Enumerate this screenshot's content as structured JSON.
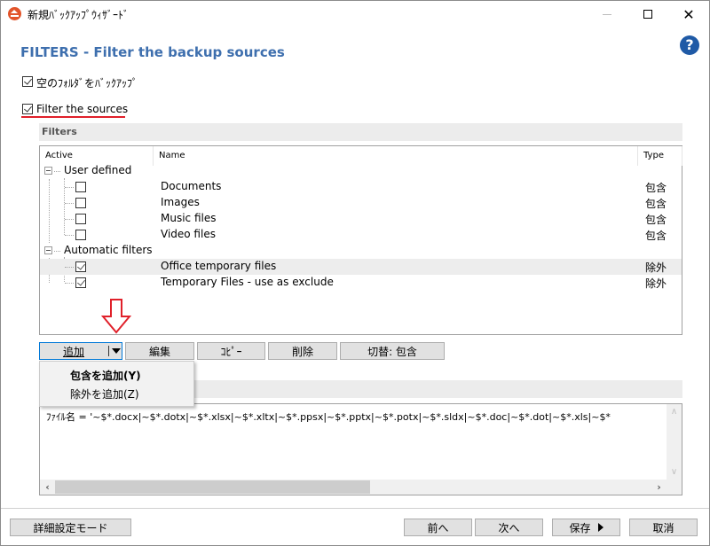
{
  "window": {
    "title": "新規ﾊﾞｯｸｱｯﾌﾟｳｨｻﾞｰﾄﾞ",
    "controls": {
      "minimize": "—",
      "maximize": "☐",
      "close": "✕"
    }
  },
  "header": {
    "title": "FILTERS - Filter the backup sources",
    "help_icon": "?"
  },
  "options": {
    "backup_empty_folders": {
      "label": "空のﾌｫﾙﾀﾞをﾊﾞｯｸｱｯﾌﾟ",
      "checked": true
    },
    "filter_sources": {
      "label": "Filter the sources",
      "checked": true
    }
  },
  "filters_section": {
    "title": "Filters",
    "columns": {
      "active": "Active",
      "name": "Name",
      "type": "Type"
    },
    "groups": [
      {
        "label": "User defined",
        "items": [
          {
            "name": "Documents",
            "type": "包含",
            "active": false
          },
          {
            "name": "Images",
            "type": "包含",
            "active": false
          },
          {
            "name": "Music files",
            "type": "包含",
            "active": false
          },
          {
            "name": "Video files",
            "type": "包含",
            "active": false
          }
        ]
      },
      {
        "label": "Automatic filters",
        "items": [
          {
            "name": "Office temporary files",
            "type": "除外",
            "active": true,
            "selected": true
          },
          {
            "name": "Temporary Files - use as exclude",
            "type": "除外",
            "active": true
          }
        ]
      }
    ]
  },
  "toolbar": {
    "add": "追加",
    "edit": "編集",
    "copy": "ｺﾋﾟｰ",
    "delete": "削除",
    "toggle": "切替: 包含"
  },
  "add_menu": {
    "items": [
      {
        "label": "包含を追加(Y)",
        "bold": true
      },
      {
        "label": "除外を追加(Z)",
        "bold": false
      }
    ]
  },
  "expression": {
    "text": "ﾌｧｲﾙ名 = '~$*.docx|~$*.dotx|~$*.xlsx|~$*.xltx|~$*.ppsx|~$*.pptx|~$*.potx|~$*.sldx|~$*.doc|~$*.dot|~$*.xls|~$*"
  },
  "footer": {
    "advanced_mode": "詳細設定モード",
    "back": "前へ",
    "next": "次へ",
    "save": "保存",
    "cancel": "取消"
  },
  "colors": {
    "title_blue": "#3e6fae",
    "help_blue": "#1f5aa6",
    "annotation_red": "#e0202a",
    "focus_blue": "#0078d7",
    "app_icon_orange": "#e2542a"
  }
}
